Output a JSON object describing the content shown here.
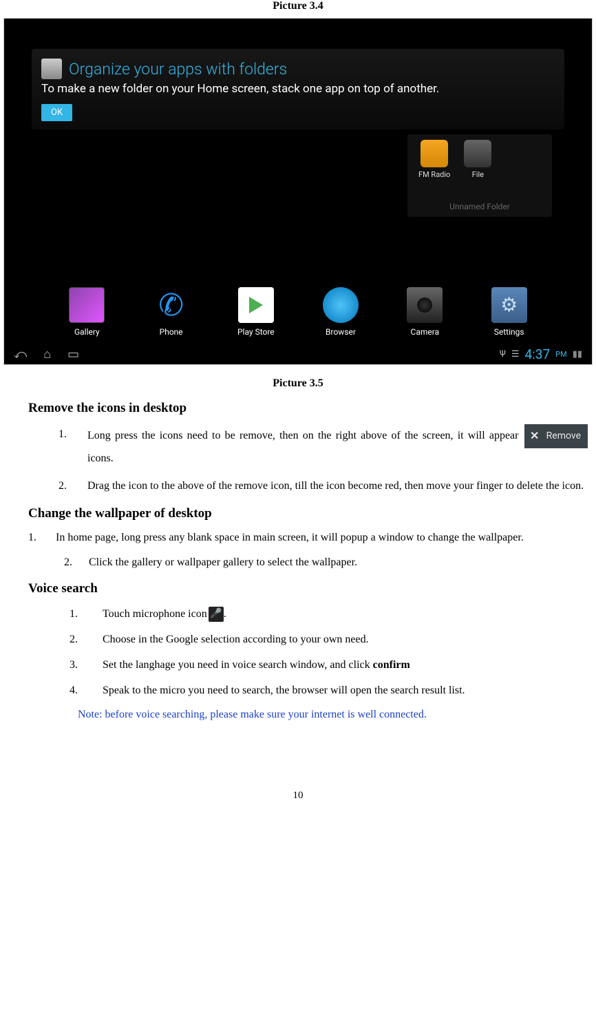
{
  "figure_label_top": "Picture 3.4",
  "figure_label_mid": "Picture 3.5",
  "screenshot": {
    "tip": {
      "title": "Organize your apps with folders",
      "body": "To make a new folder on your Home screen, stack one app on top of another.",
      "ok": "OK"
    },
    "folder": {
      "items": [
        {
          "label": "FM Radio"
        },
        {
          "label": "File"
        }
      ],
      "name": "Unnamed Folder"
    },
    "dock": [
      {
        "label": "Gallery"
      },
      {
        "label": "Phone"
      },
      {
        "label": "Play Store"
      },
      {
        "label": "Browser"
      },
      {
        "label": "Camera"
      },
      {
        "label": "Settings"
      }
    ],
    "clock": {
      "time": "4:37",
      "suffix": "PM"
    }
  },
  "sections": {
    "remove": {
      "heading": "Remove the icons in desktop",
      "items": [
        {
          "num": "1.",
          "pre": "Long press the icons need to be remove, then on the right above of the screen, it will appear ",
          "chip_label": "Remove",
          "post": " icons."
        },
        {
          "num": "2.",
          "text": "Drag the icon to the above of the remove icon, till the icon become red, then move your finger to delete the icon."
        }
      ]
    },
    "wallpaper": {
      "heading": "Change the wallpaper of desktop",
      "items": [
        {
          "num": "1.",
          "text": "In home page, long press any blank space in main screen, it will popup a window to change the wallpaper."
        }
      ],
      "sub": [
        {
          "num": "2.",
          "text": "Click the gallery or wallpaper gallery to select the wallpaper."
        }
      ]
    },
    "voice": {
      "heading": "Voice search",
      "items": [
        {
          "num": "1.",
          "pre": "Touch microphone icon",
          "post": "."
        },
        {
          "num": "2.",
          "text": "Choose in the Google selection according to your own need."
        },
        {
          "num": "3.",
          "pre": "Set the langhage you need in voice search window, and click ",
          "bold": "confirm"
        },
        {
          "num": "4.",
          "text": "Speak to the micro you need to search, the browser will open the search result list."
        }
      ],
      "note": "Note: before voice searching, please make sure your internet is well connected."
    }
  },
  "page_number": "10"
}
